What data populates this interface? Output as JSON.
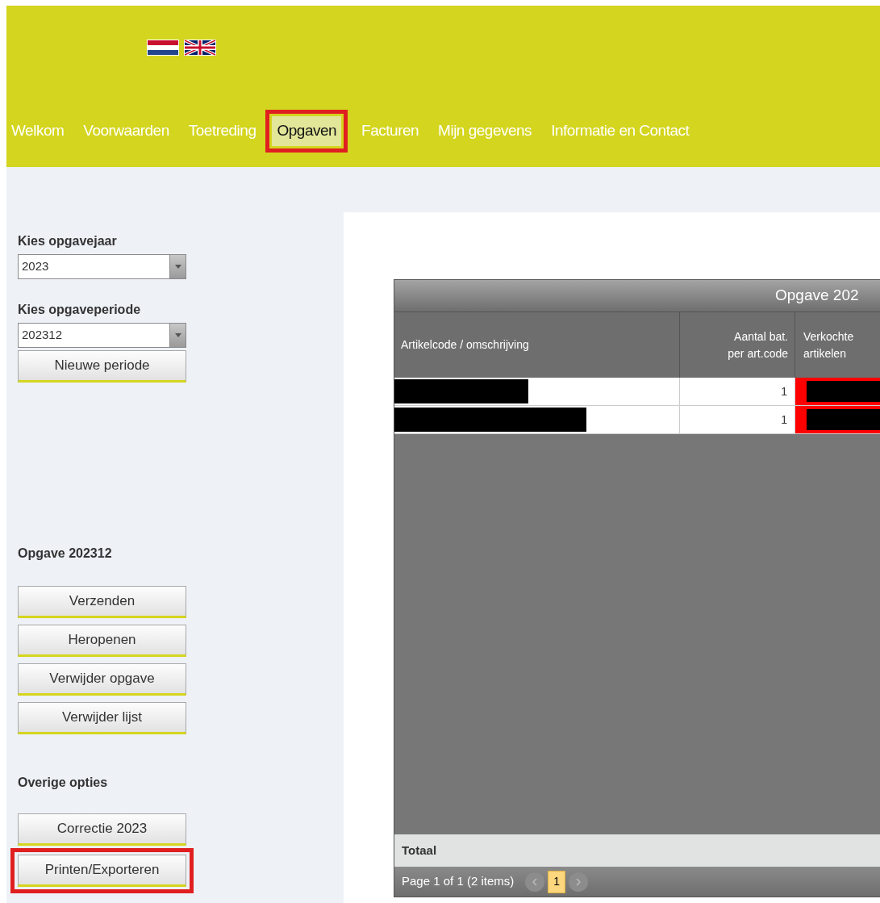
{
  "nav": [
    {
      "label": "Welkom",
      "selected": false,
      "highlighted": false
    },
    {
      "label": "Voorwaarden",
      "selected": false,
      "highlighted": false
    },
    {
      "label": "Toetreding",
      "selected": false,
      "highlighted": false
    },
    {
      "label": "Opgaven",
      "selected": true,
      "highlighted": true
    },
    {
      "label": "Facturen",
      "selected": false,
      "highlighted": false
    },
    {
      "label": "Mijn gegevens",
      "selected": false,
      "highlighted": false
    },
    {
      "label": "Informatie en Contact",
      "selected": false,
      "highlighted": false
    }
  ],
  "sidebar": {
    "year": {
      "label": "Kies opgavejaar",
      "value": "2023"
    },
    "period": {
      "label": "Kies opgaveperiode",
      "value": "202312"
    },
    "new_period_button": {
      "label": "Nieuwe periode",
      "highlighted": false
    },
    "section_title": "Opgave 202312",
    "actions": [
      {
        "label": "Verzenden",
        "highlighted": false
      },
      {
        "label": "Heropenen",
        "highlighted": false
      },
      {
        "label": "Verwijder opgave",
        "highlighted": false
      },
      {
        "label": "Verwijder lijst",
        "highlighted": false
      }
    ],
    "other_title": "Overige opties",
    "other_actions": [
      {
        "label": "Correctie 2023",
        "highlighted": false
      },
      {
        "label": "Printen/Exporteren",
        "highlighted": true
      }
    ]
  },
  "grid": {
    "title": "Opgave 202",
    "columns": [
      {
        "lines": [
          "Artikelcode / omschrijving"
        ]
      },
      {
        "lines": [
          "Aantal bat.",
          "per art.code"
        ]
      },
      {
        "lines": [
          "Verkochte",
          "artikelen"
        ]
      }
    ],
    "rows": [
      {
        "aantal": "1"
      },
      {
        "aantal": "1"
      }
    ],
    "footer_label": "Totaal",
    "pager": {
      "summary": "Page 1 of 1 (2 items)",
      "pages": [
        {
          "label": "1",
          "selected": true
        }
      ]
    }
  }
}
